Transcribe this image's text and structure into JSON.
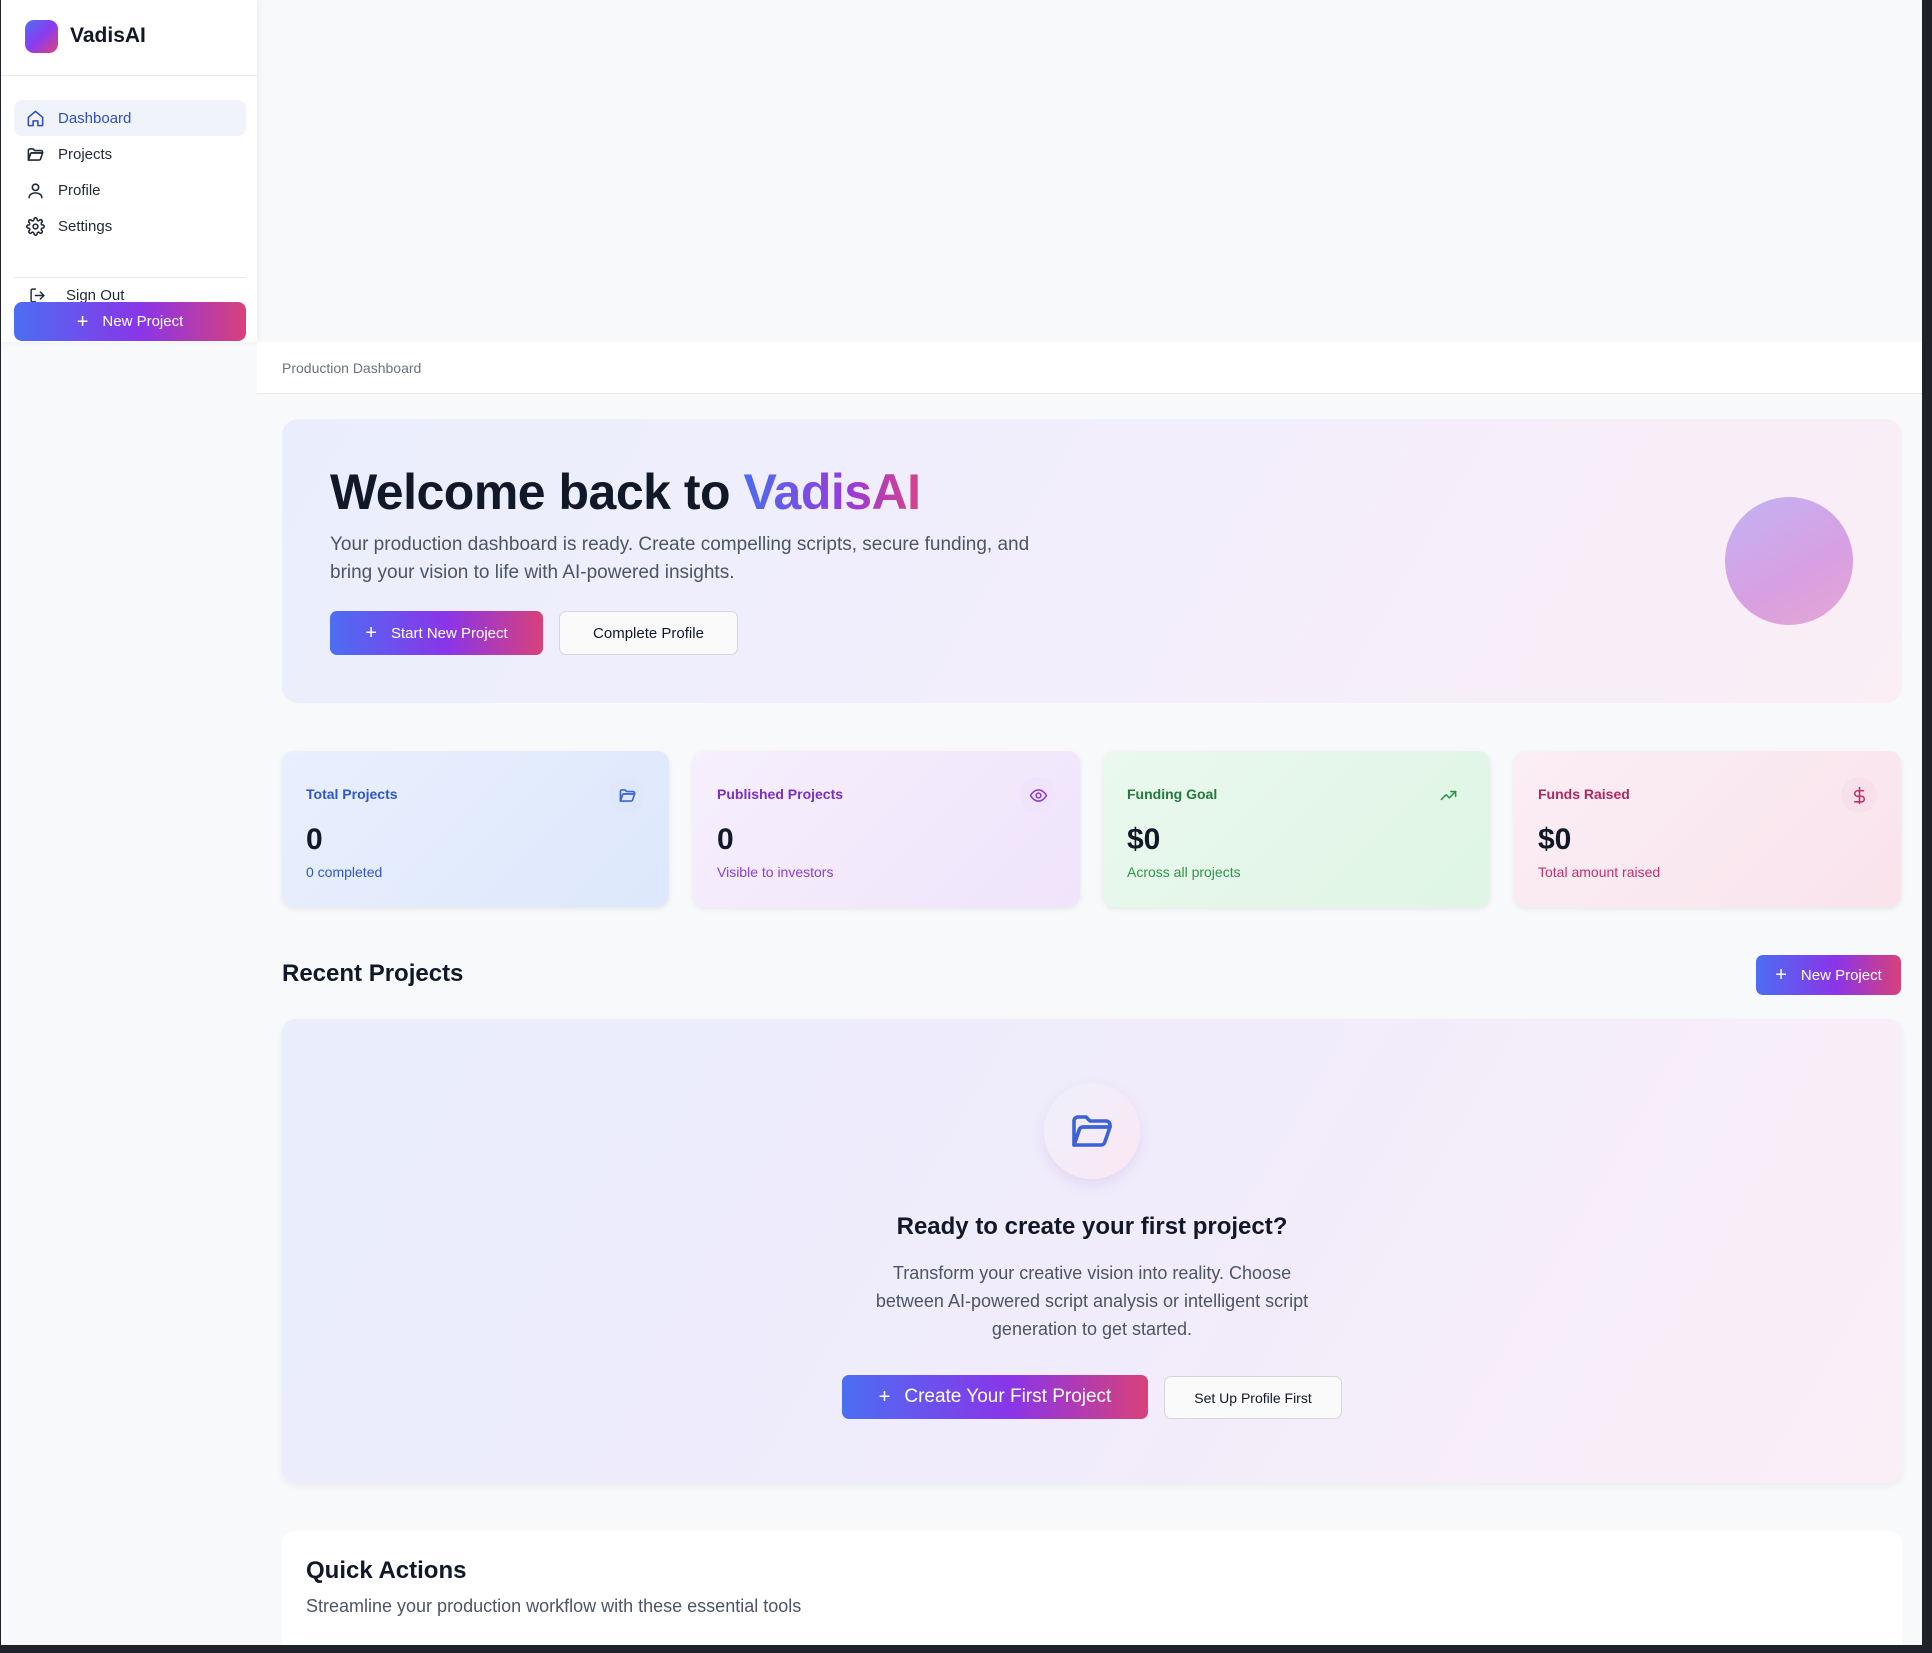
{
  "brand": {
    "name": "VadisAI"
  },
  "sidebar": {
    "items": [
      {
        "label": "Dashboard",
        "icon": "home-icon",
        "active": true
      },
      {
        "label": "Projects",
        "icon": "folder-icon",
        "active": false
      },
      {
        "label": "Profile",
        "icon": "user-icon",
        "active": false
      },
      {
        "label": "Settings",
        "icon": "gear-icon",
        "active": false
      }
    ],
    "sign_out": "Sign Out",
    "new_project": "New Project"
  },
  "topbar": {
    "title": "Production Dashboard"
  },
  "welcome": {
    "title_prefix": "Welcome back to ",
    "title_brand": "VadisAI",
    "subtitle": "Your production dashboard is ready. Create compelling scripts, secure funding, and bring your vision to life with AI-powered insights.",
    "start_button": "Start New Project",
    "profile_button": "Complete Profile"
  },
  "stats": [
    {
      "label": "Total Projects",
      "value": "0",
      "sub": "0 completed",
      "icon": "folder-open-icon"
    },
    {
      "label": "Published Projects",
      "value": "0",
      "sub": "Visible to investors",
      "icon": "eye-icon"
    },
    {
      "label": "Funding Goal",
      "value": "$0",
      "sub": "Across all projects",
      "icon": "trending-up-icon"
    },
    {
      "label": "Funds Raised",
      "value": "$0",
      "sub": "Total amount raised",
      "icon": "dollar-icon"
    }
  ],
  "recent": {
    "title": "Recent Projects",
    "new_button": "New Project",
    "empty_title": "Ready to create your first project?",
    "empty_sub": "Transform your creative vision into reality. Choose between AI-powered script analysis or intelligent script generation to get started.",
    "create_button": "Create Your First Project",
    "profile_button": "Set Up Profile First"
  },
  "quick_actions": {
    "title": "Quick Actions",
    "subtitle": "Streamline your production workflow with these essential tools"
  },
  "colors": {
    "accent_blue": "#4c6ef2",
    "accent_purple": "#8a35e8",
    "accent_pink": "#d8417a",
    "active_nav_bg": "#f1f3fa"
  }
}
